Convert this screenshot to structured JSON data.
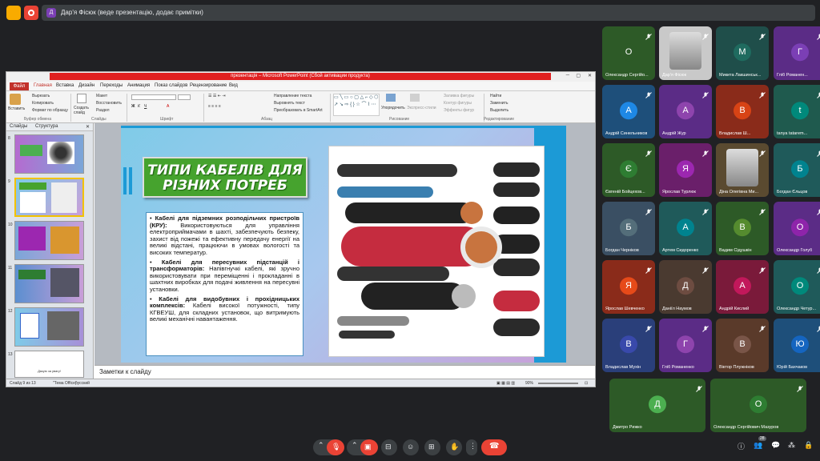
{
  "meet": {
    "presenter_avatar": "Д",
    "presenter_text": "Дар'я Фісюк (веде презентацію, додає примітки)",
    "participant_count": "28"
  },
  "ppt": {
    "title_bar": "презентація – Microsoft PowerPoint (Сбой активации продукта)",
    "tabs": [
      "Файл",
      "Главная",
      "Вставка",
      "Дизайн",
      "Переходы",
      "Анимация",
      "Показ слайдов",
      "Рецензирование",
      "Вид"
    ],
    "ribbon": {
      "paste": "Вставить",
      "cut": "Вырезать",
      "copy": "Копировать",
      "format_painter": "Формат по образцу",
      "clipboard_group": "Буфер обмена",
      "new_slide": "Создать слайд",
      "layout": "Макет",
      "reset": "Восстановить",
      "section": "Раздел",
      "slides_group": "Слайды",
      "font_group": "Шрифт",
      "text_direction": "Направление текста",
      "align_text": "Выровнять текст",
      "smartart": "Преобразовать в SmartArt",
      "paragraph_group": "Абзац",
      "arrange": "Упорядочить",
      "quick_styles": "Экспресс-стили",
      "shape_fill": "Заливка фигуры",
      "shape_outline": "Контур фигуры",
      "shape_effects": "Эффекты фигур",
      "drawing_group": "Рисование",
      "find": "Найти",
      "replace": "Заменить",
      "select": "Выделить",
      "editing_group": "Редактирование"
    },
    "pane_tabs": [
      "Слайды",
      "Структура"
    ],
    "thumb_numbers": [
      "8",
      "9",
      "10",
      "11",
      "12",
      "13"
    ],
    "thumb13_text": "Дякую за увагу!",
    "slide": {
      "title": "ТИПИ КАБЕЛІВ ДЛЯ РІЗНИХ ПОТРЕБ",
      "items": [
        {
          "bold": "Кабелі для підземних розподільчих пристроїв (КРУ):",
          "text": " Використовуються для управління електроприймачами в шахті, забезпечують безпеку, захист від пожежі та ефективну передачу енергії на великі відстані, працюючи в умовах вологості та високих температур."
        },
        {
          "bold": "Кабелі для пересувних підстанцій і трансформаторів:",
          "text": " Напівгнучкі кабелі, які зручно використовувати при переміщенні і прокладанні в шахтних виробках для подачі живлення на пересувні установки."
        },
        {
          "bold": "Кабелі для видобувних і прохідницьких комплексів:",
          "text": " Кабелі високої потужності, типу КГВЕУШ, для складних установок, що витримують великі механічні навантаження."
        }
      ]
    },
    "notes_placeholder": "Заметки к слайду",
    "status": {
      "slide": "Слайд 9 из 13",
      "theme": "\"Тема Office\"",
      "lang": "русский",
      "zoom": "90%"
    }
  },
  "participants": [
    {
      "initial": "О",
      "name": "Олександр Сергійо...",
      "bg": "#2d5a27",
      "av": "#2d5a27"
    },
    {
      "initial": "",
      "name": "Дар'я Фісюк",
      "bg": "#c9c9c9",
      "av": "",
      "photo": true
    },
    {
      "initial": "М",
      "name": "Микита Лакшинськ...",
      "bg": "#1f4e4a",
      "av": "#1f6b5f"
    },
    {
      "initial": "Г",
      "name": "Гліб Романен...",
      "bg": "#5b2c86",
      "av": "#7b3fb5"
    },
    {
      "initial": "А",
      "name": "Андрій Синельников",
      "bg": "#1e4f7a",
      "av": "#1e88e5"
    },
    {
      "initial": "А",
      "name": "Андрій Жур",
      "bg": "#5b2c86",
      "av": "#8e44ad"
    },
    {
      "initial": "В",
      "name": "Владислав Ш...",
      "bg": "#8a2b1a",
      "av": "#d84315"
    },
    {
      "initial": "t",
      "name": "tanya tatarem...",
      "bg": "#1f5a4e",
      "av": "#00897b"
    },
    {
      "initial": "Є",
      "name": "Євгеній Бойцехов...",
      "bg": "#2d5a27",
      "av": "#2e7d32"
    },
    {
      "initial": "Я",
      "name": "Ярослав Турлюк",
      "bg": "#6a1f6a",
      "av": "#9c27b0"
    },
    {
      "initial": "",
      "name": "Діна Олегівна Ми...",
      "bg": "#5a4a30",
      "av": "",
      "photo": true
    },
    {
      "initial": "Б",
      "name": "Богдан Єльцов",
      "bg": "#1f5a5a",
      "av": "#00838f"
    },
    {
      "initial": "Б",
      "name": "Богдан Черніков",
      "bg": "#3a4f63",
      "av": "#546e7a"
    },
    {
      "initial": "А",
      "name": "Артем Сидоренко",
      "bg": "#1f5a5a",
      "av": "#00838f"
    },
    {
      "initial": "В",
      "name": "Вадим Сідушкін",
      "bg": "#2d5a27",
      "av": "#558b2f"
    },
    {
      "initial": "О",
      "name": "Олександр Голуб",
      "bg": "#5b2c86",
      "av": "#8e24aa"
    },
    {
      "initial": "Я",
      "name": "Ярослав Шевченко",
      "bg": "#8a2b1a",
      "av": "#e64a19"
    },
    {
      "initial": "Д",
      "name": "Даніїл Наумов",
      "bg": "#4a3a30",
      "av": "#6d4c41"
    },
    {
      "initial": "А",
      "name": "Андрій Кислий",
      "bg": "#7a1a3a",
      "av": "#c2185b"
    },
    {
      "initial": "О",
      "name": "Олександр Четур...",
      "bg": "#1f5a5a",
      "av": "#00897b"
    },
    {
      "initial": "В",
      "name": "Владислав Мухін",
      "bg": "#2a3f7a",
      "av": "#3949ab"
    },
    {
      "initial": "Г",
      "name": "Гліб Романенко",
      "bg": "#5b2c86",
      "av": "#8e44ad"
    },
    {
      "initial": "В",
      "name": "Віктор Плужніков",
      "bg": "#5a3a2a",
      "av": "#795548"
    },
    {
      "initial": "Ю",
      "name": "Юрій Бахчаков",
      "bg": "#1e4f7a",
      "av": "#1565c0"
    },
    {
      "initial": "Д",
      "name": "Дмитро Рижко",
      "bg": "#2d5a27",
      "av": "#4caf50"
    },
    {
      "initial": "О",
      "name": "Олександр Сергійович Мазуров",
      "bg": "#2d5a27",
      "av": "#2e7d32"
    }
  ]
}
